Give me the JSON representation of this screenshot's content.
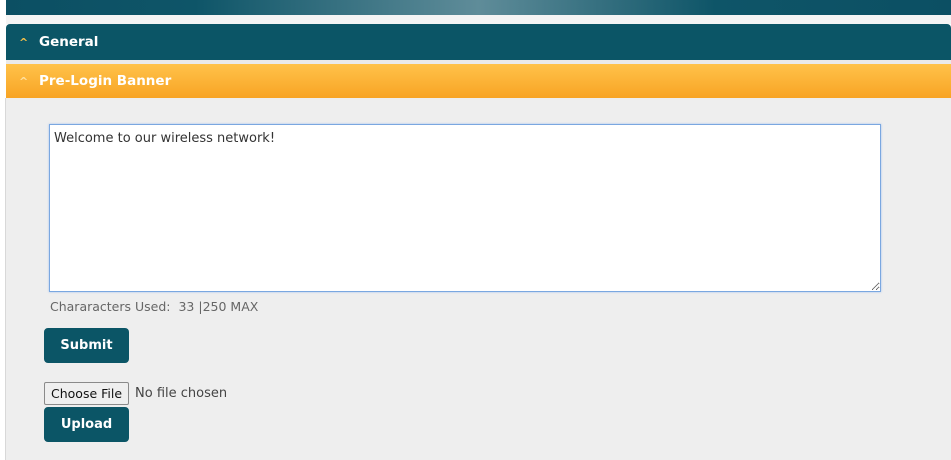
{
  "panels": {
    "general": {
      "title": "General",
      "chevron": "^"
    },
    "banner": {
      "title": "Pre-Login Banner",
      "chevron": "^"
    }
  },
  "banner": {
    "text": "Welcome to our wireless network!\n",
    "chars_label": "Chararacters Used:",
    "chars_used": "33",
    "chars_max": "|250 MAX",
    "submit_label": "Submit"
  },
  "upload": {
    "choose_label": "Choose File",
    "no_file_text": "No file chosen",
    "upload_label": "Upload"
  },
  "colors": {
    "header_teal": "#0b5566",
    "banner_orange": "#f8a424",
    "body_gray": "#eeeeee"
  },
  "icons": {
    "collapse": "chevron-up-icon"
  }
}
